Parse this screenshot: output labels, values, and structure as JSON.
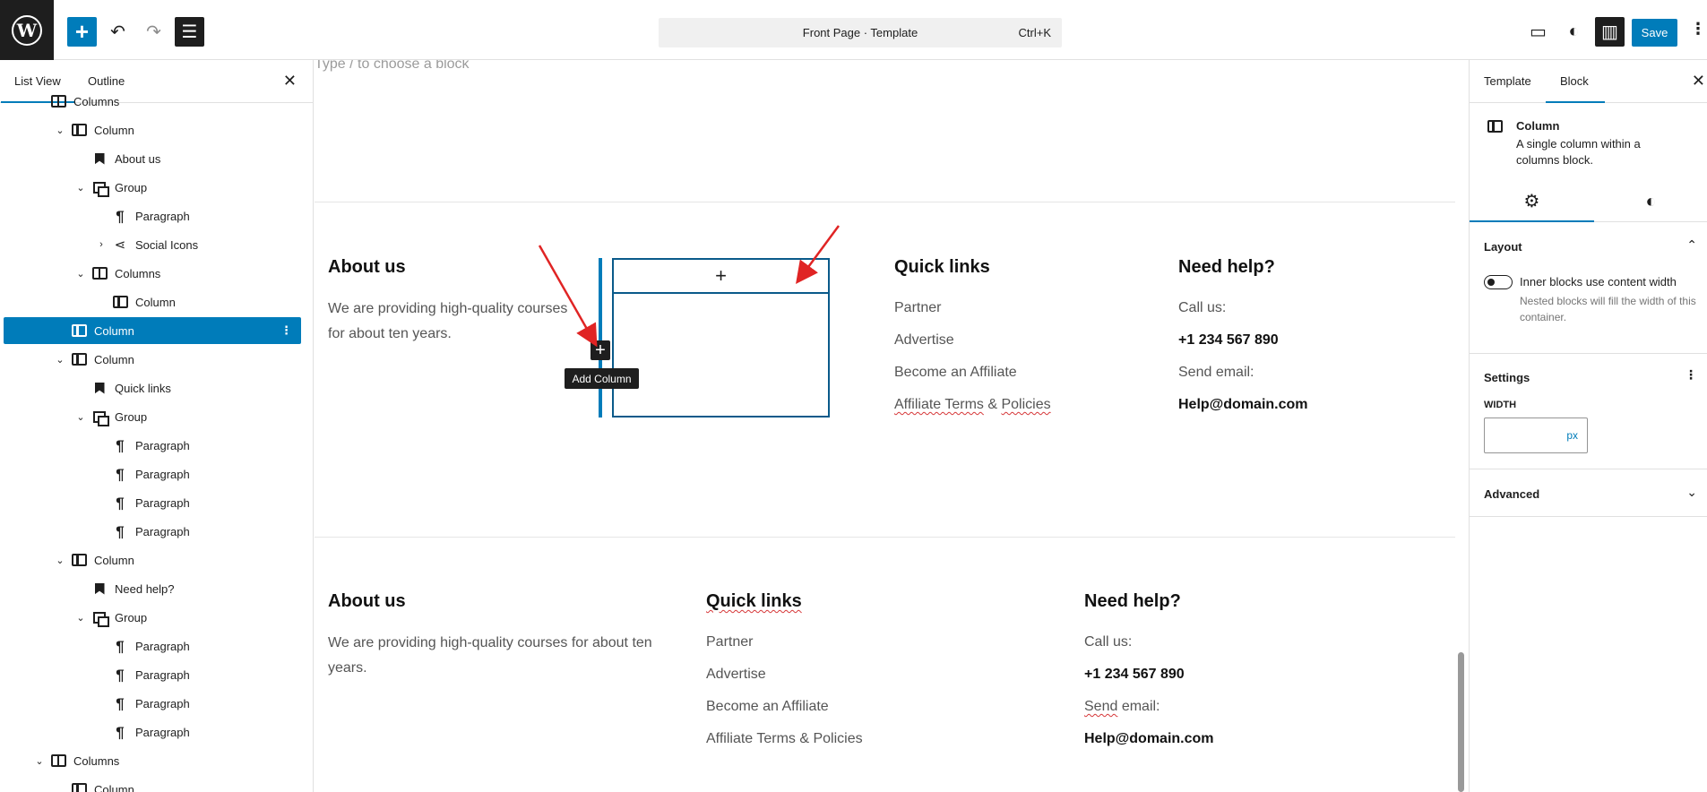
{
  "toolbar": {
    "logo": "W",
    "add_icon": "+",
    "undo_icon": "↶",
    "redo_icon": "↷",
    "listview_icon": "☰",
    "command_title": "Front Page · Template",
    "command_shortcut": "Ctrl+K",
    "view_icon": "▭",
    "styles_icon": "◐",
    "settings_icon": "▥",
    "save_label": "Save",
    "options_icon": "⋮"
  },
  "left_panel": {
    "tabs": [
      "List View",
      "Outline"
    ],
    "close_icon": "✕",
    "tree": [
      {
        "label": "Columns",
        "icon": "columns-icon",
        "chev": ""
      },
      {
        "label": "Column",
        "icon": "column-icon",
        "chev": "⌄"
      },
      {
        "label": "About us",
        "icon": "bookmark-icon",
        "chev": ""
      },
      {
        "label": "Group",
        "icon": "group-icon",
        "chev": "⌄"
      },
      {
        "label": "Paragraph",
        "icon": "paragraph-icon",
        "chev": ""
      },
      {
        "label": "Social Icons",
        "icon": "share-icon",
        "chev": "›"
      },
      {
        "label": "Columns",
        "icon": "columns-icon",
        "chev": "⌄"
      },
      {
        "label": "Column",
        "icon": "column-icon",
        "chev": ""
      },
      {
        "label": "Column",
        "icon": "column-icon",
        "chev": ""
      },
      {
        "label": "Column",
        "icon": "column-icon",
        "chev": "⌄"
      },
      {
        "label": "Quick links",
        "icon": "bookmark-icon",
        "chev": ""
      },
      {
        "label": "Group",
        "icon": "group-icon",
        "chev": "⌄"
      },
      {
        "label": "Paragraph",
        "icon": "paragraph-icon",
        "chev": ""
      },
      {
        "label": "Paragraph",
        "icon": "paragraph-icon",
        "chev": ""
      },
      {
        "label": "Paragraph",
        "icon": "paragraph-icon",
        "chev": ""
      },
      {
        "label": "Paragraph",
        "icon": "paragraph-icon",
        "chev": ""
      },
      {
        "label": "Column",
        "icon": "column-icon",
        "chev": "⌄"
      },
      {
        "label": "Need help?",
        "icon": "bookmark-icon",
        "chev": ""
      },
      {
        "label": "Group",
        "icon": "group-icon",
        "chev": "⌄"
      },
      {
        "label": "Paragraph",
        "icon": "paragraph-icon",
        "chev": ""
      },
      {
        "label": "Paragraph",
        "icon": "paragraph-icon",
        "chev": ""
      },
      {
        "label": "Paragraph",
        "icon": "paragraph-icon",
        "chev": ""
      },
      {
        "label": "Paragraph",
        "icon": "paragraph-icon",
        "chev": ""
      },
      {
        "label": "Columns",
        "icon": "columns-icon",
        "chev": "⌄"
      },
      {
        "label": "Column",
        "icon": "column-icon",
        "chev": ""
      }
    ],
    "selected_options": "⋮"
  },
  "canvas": {
    "placeholder": "Type / to choose a block",
    "section1": {
      "about_heading": "About us",
      "about_text_1": "We are providing high-quality courses",
      "about_text_2": "for about ten years.",
      "appender": "+",
      "add_column_icon": "+",
      "add_column_tooltip": "Add Column",
      "quick_heading": "Quick links",
      "links": [
        "Partner",
        "Advertise",
        "Become an Affiliate"
      ],
      "link4_a": "Affiliate Terms",
      "link4_b": " & ",
      "link4_c": "Policies",
      "help_heading": "Need help?",
      "call_label": "Call us:",
      "phone": "+1 234 567 890",
      "email_label": "Send email:",
      "email": "Help@domain.com"
    },
    "section2": {
      "about_heading": "About us",
      "about_text_1": "We are providing high-quality courses for about ten",
      "about_text_2": "years.",
      "quick_heading": "Quick links",
      "links": [
        "Partner",
        "Advertise",
        "Become an Affiliate",
        "Affiliate Terms & Policies"
      ],
      "help_heading": "Need help?",
      "call_label": "Call us:",
      "phone": "+1 234 567 890",
      "email_label_a": "Send",
      "email_label_b": " email:",
      "email": "Help@domain.com"
    },
    "scroll_up": "▲"
  },
  "right_panel": {
    "tabs": [
      "Template",
      "Block"
    ],
    "close_icon": "✕",
    "block_title": "Column",
    "block_desc": "A single column within a columns block.",
    "settings_tab_icon": "⚙",
    "styles_tab_icon": "◐",
    "layout": {
      "title": "Layout",
      "arrow": "⌃",
      "toggle_label": "Inner blocks use content width",
      "toggle_help": "Nested blocks will fill the width of this container."
    },
    "settings": {
      "title": "Settings",
      "menu": "⋮",
      "width_label": "WIDTH",
      "width_value": "",
      "unit": "px"
    },
    "advanced": {
      "title": "Advanced",
      "arrow": "⌄"
    }
  },
  "colors": {
    "accent": "#007cba",
    "dark": "#1e1e1e",
    "arrow": "#e02424"
  }
}
